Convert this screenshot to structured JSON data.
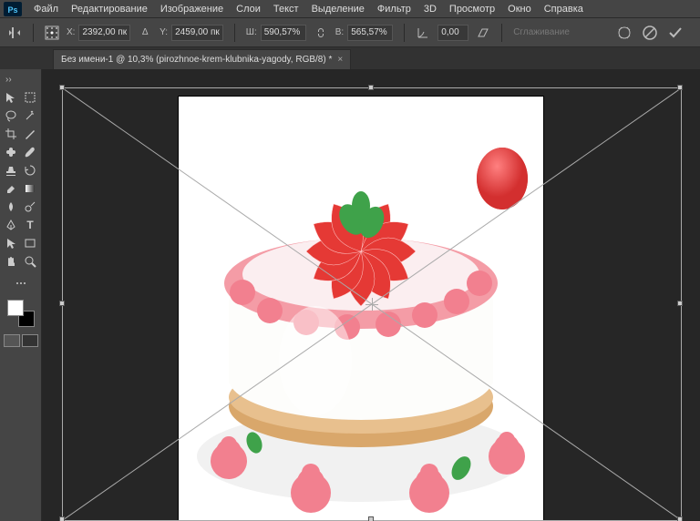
{
  "menu": {
    "items": [
      "Файл",
      "Редактирование",
      "Изображение",
      "Слои",
      "Текст",
      "Выделение",
      "Фильтр",
      "3D",
      "Просмотр",
      "Окно",
      "Справка"
    ]
  },
  "options": {
    "x_label": "X:",
    "x_value": "2392,00 пк",
    "y_label": "Y:",
    "y_value": "2459,00 пк",
    "w_label": "Ш:",
    "w_value": "590,57%",
    "h_label": "В:",
    "h_value": "565,57%",
    "angle_value": "0,00",
    "interp_label": "Сглаживание"
  },
  "tab": {
    "title": "Без имени-1 @ 10,3% (pirozhnoe-krem-klubnika-yagody, RGB/8) *"
  },
  "colors": {
    "menubg": "#454545",
    "workbg": "#262626"
  }
}
